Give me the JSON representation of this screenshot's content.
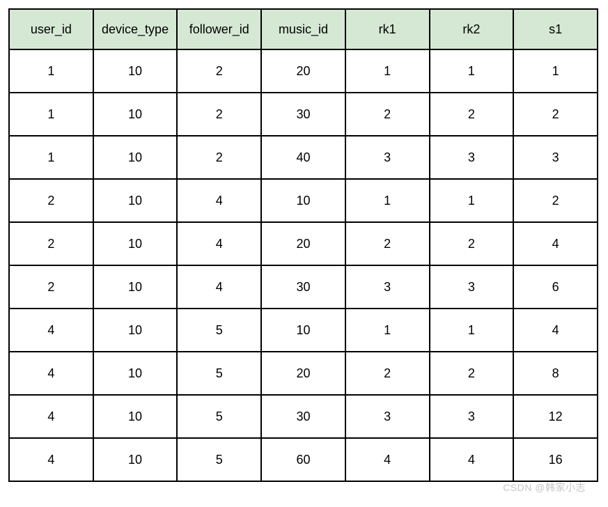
{
  "chart_data": {
    "type": "table",
    "headers": [
      "user_id",
      "device_type",
      "follower_id",
      "music_id",
      "rk1",
      "rk2",
      "s1"
    ],
    "rows": [
      [
        1,
        10,
        2,
        20,
        1,
        1,
        1
      ],
      [
        1,
        10,
        2,
        30,
        2,
        2,
        2
      ],
      [
        1,
        10,
        2,
        40,
        3,
        3,
        3
      ],
      [
        2,
        10,
        4,
        10,
        1,
        1,
        2
      ],
      [
        2,
        10,
        4,
        20,
        2,
        2,
        4
      ],
      [
        2,
        10,
        4,
        30,
        3,
        3,
        6
      ],
      [
        4,
        10,
        5,
        10,
        1,
        1,
        4
      ],
      [
        4,
        10,
        5,
        20,
        2,
        2,
        8
      ],
      [
        4,
        10,
        5,
        30,
        3,
        3,
        12
      ],
      [
        4,
        10,
        5,
        60,
        4,
        4,
        16
      ]
    ]
  },
  "watermark": "CSDN @韩家小志"
}
